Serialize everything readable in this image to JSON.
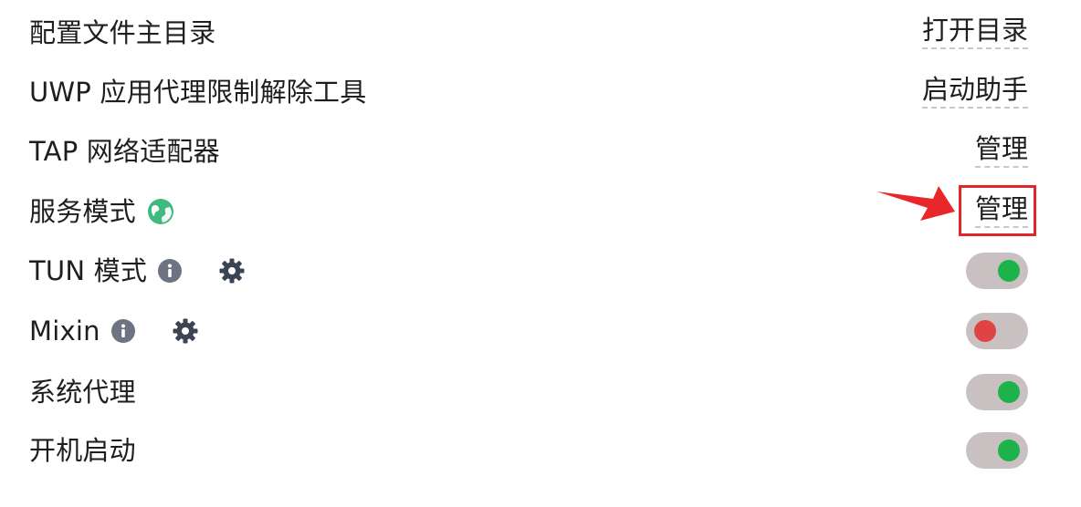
{
  "settings": {
    "rows": [
      {
        "label": "配置文件主目录",
        "action": "打开目录"
      },
      {
        "label": "UWP 应用代理限制解除工具",
        "action": "启动助手"
      },
      {
        "label": "TAP 网络适配器",
        "action": "管理"
      },
      {
        "label": "服务模式",
        "action": "管理",
        "status_icon": "globe-icon",
        "status_color": "#3dba7f"
      },
      {
        "label": "TUN 模式",
        "toggle": "on",
        "icons": [
          "info-icon",
          "gear-icon"
        ]
      },
      {
        "label": "Mixin",
        "toggle": "off",
        "icons": [
          "info-icon",
          "gear-icon"
        ]
      },
      {
        "label": "系统代理",
        "toggle": "on"
      },
      {
        "label": "开机启动",
        "toggle": "on"
      }
    ]
  },
  "colors": {
    "toggle_track": "#c9c1c1",
    "toggle_on": "#1db34a",
    "toggle_off": "#e04343",
    "highlight": "#e0262a",
    "icon_gray": "#6b7480",
    "gear_dark": "#3a4453"
  },
  "annotation": {
    "highlighted_element": "service-mode-manage-button",
    "pointer": "red-arrow"
  }
}
